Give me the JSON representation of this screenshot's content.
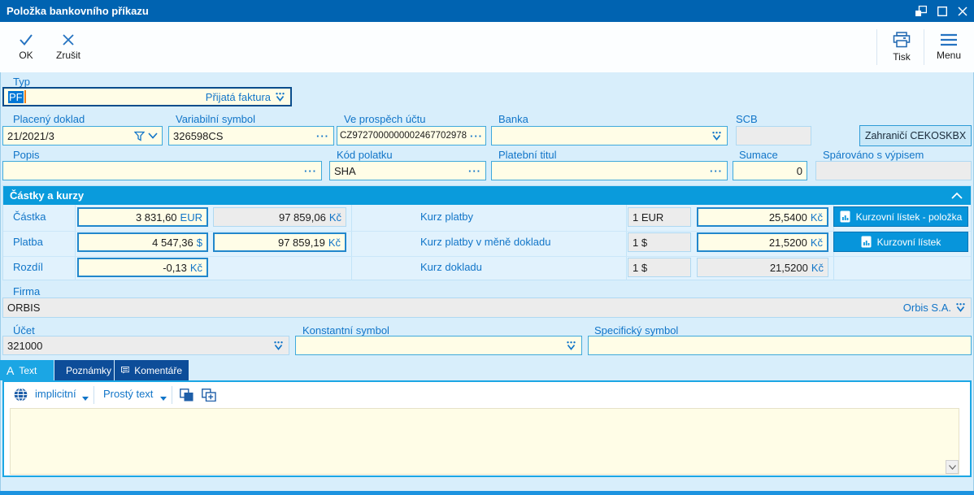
{
  "window": {
    "title": "Položka bankovního příkazu"
  },
  "toolbar": {
    "ok_label": "OK",
    "cancel_label": "Zrušit",
    "print_label": "Tisk",
    "menu_label": "Menu"
  },
  "form": {
    "typ": {
      "label": "Typ",
      "code": "PF",
      "display": "Přijatá faktura"
    },
    "placeny_doklad": {
      "label": "Placený doklad",
      "value": "21/2021/3"
    },
    "variabilni_symbol": {
      "label": "Variabilní symbol",
      "value": "326598CS"
    },
    "ve_prospech_uctu": {
      "label": "Ve prospěch účtu",
      "value": "CZ9727000000002467702978"
    },
    "banka": {
      "label": "Banka",
      "value": ""
    },
    "scb": {
      "label": "SCB",
      "value": ""
    },
    "zahranici_button_label": "Zahraničí CEKOSKBX",
    "popis": {
      "label": "Popis",
      "value": ""
    },
    "kod_poplatku": {
      "label": "Kód polatku",
      "value": "SHA"
    },
    "platebni_titul": {
      "label": "Platební titul",
      "value": ""
    },
    "sumace": {
      "label": "Sumace",
      "value": "0"
    },
    "sparovano_s_vypisem": {
      "label": "Spárováno s výpisem",
      "value": ""
    },
    "firma": {
      "label": "Firma",
      "value": "ORBIS",
      "selector": "Orbis S.A."
    },
    "ucet": {
      "label": "Účet",
      "value": "321000"
    },
    "konstantni_symbol": {
      "label": "Konstantní symbol",
      "value": ""
    },
    "specificky_symbol": {
      "label": "Specifický symbol",
      "value": ""
    }
  },
  "amounts": {
    "title": "Částky a kurzy",
    "rows": [
      {
        "label": "Částka",
        "amount": "3 831,60",
        "amount_cur": "EUR",
        "czk": "97 859,06",
        "czk_cur": "Kč",
        "rate_label": "Kurz platby",
        "unit": "1 EUR",
        "rate": "25,5400",
        "rate_cur": "Kč",
        "button_label": "Kurzovní lístek - položka"
      },
      {
        "label": "Platba",
        "amount": "4 547,36",
        "amount_cur": "$",
        "czk": "97 859,19",
        "czk_cur": "Kč",
        "rate_label": "Kurz platby v měně dokladu",
        "unit": "1 $",
        "rate": "21,5200",
        "rate_cur": "Kč",
        "button_label": "Kurzovní lístek"
      },
      {
        "label": "Rozdíl",
        "amount": "-0,13",
        "amount_cur": "Kč",
        "rate_label": "Kurz dokladu",
        "unit": "1 $",
        "rate": "21,5200",
        "rate_cur": "Kč"
      }
    ]
  },
  "tabs": [
    {
      "label": "Text"
    },
    {
      "label": "Poznámky"
    },
    {
      "label": "Komentáře"
    }
  ],
  "text_tab": {
    "language": "implicitní",
    "format": "Prostý text",
    "content": ""
  },
  "icons": {
    "ellipsis": "···",
    "a_glyph": "A"
  },
  "colors": {
    "titlebar": "#0063B1",
    "section_header": "#0A9BDC",
    "field_bg": "#FFFDE7",
    "label": "#1175C8",
    "tab_inactive": "#0D4D99",
    "tab_active": "#1BA6E4",
    "selection": "#0078D7",
    "text_caret": "#F0801A",
    "primary_button": "#0795DB"
  }
}
